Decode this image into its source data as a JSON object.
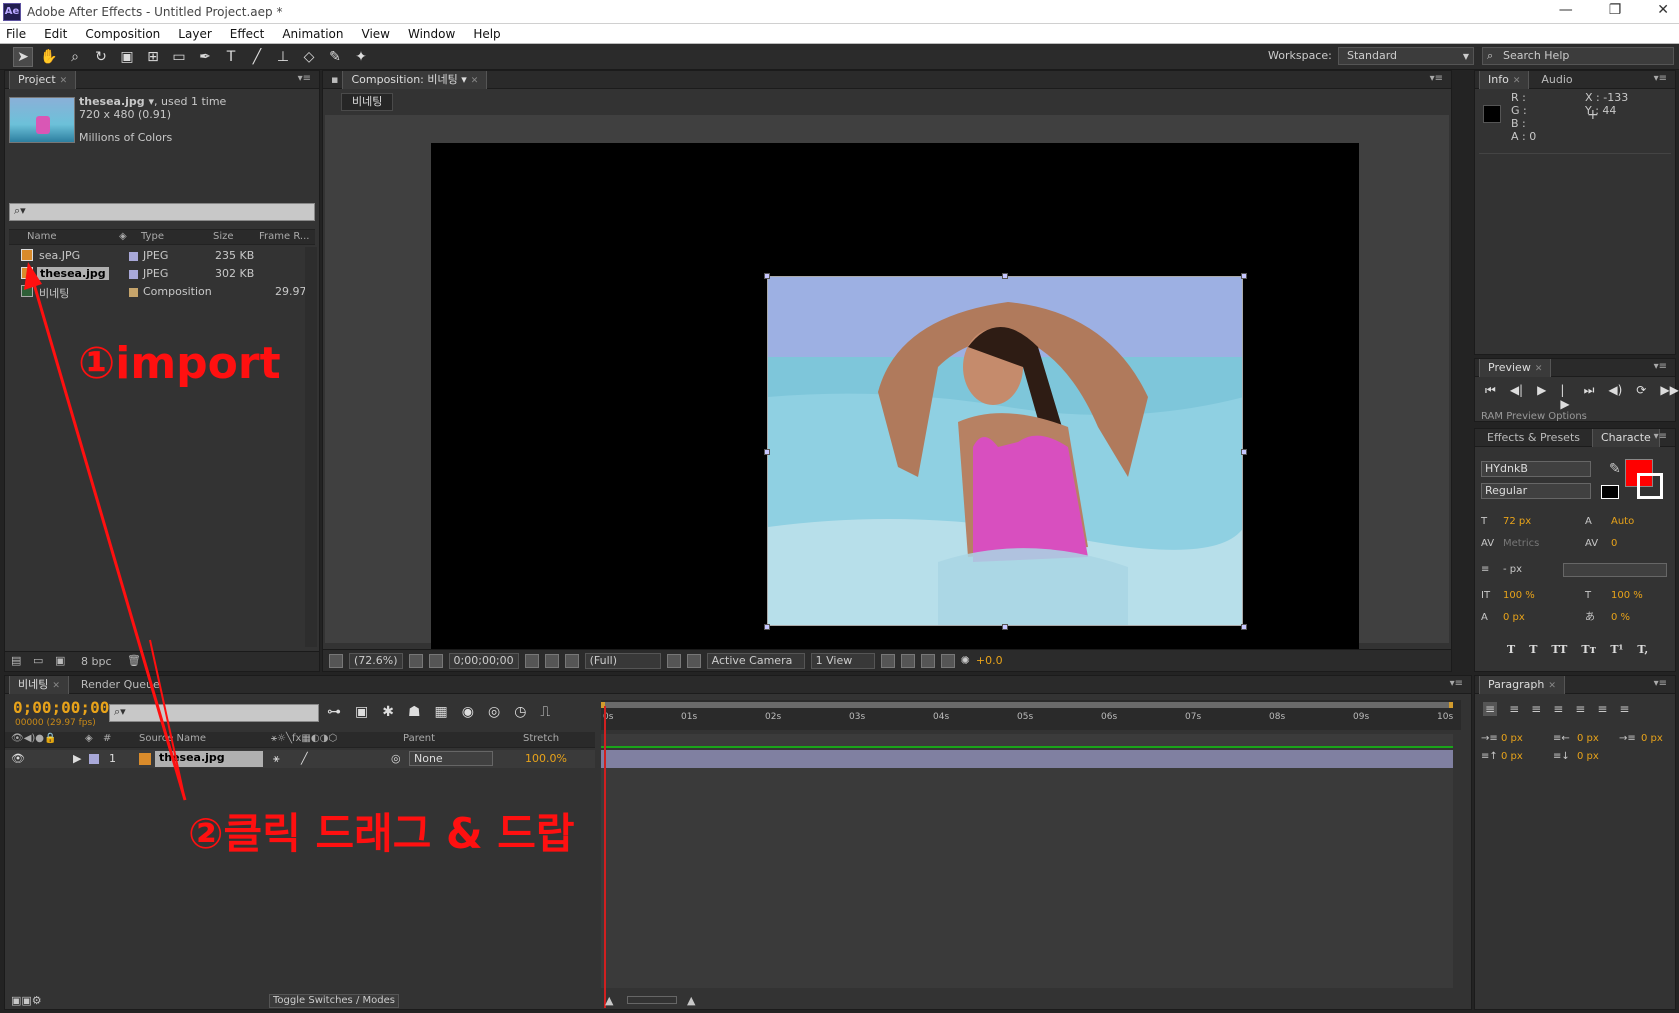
{
  "window": {
    "app_icon": "Ae",
    "title": "Adobe After Effects - Untitled Project.aep *",
    "min": "—",
    "restore": "❐",
    "close": "✕"
  },
  "menu": [
    "File",
    "Edit",
    "Composition",
    "Layer",
    "Effect",
    "Animation",
    "View",
    "Window",
    "Help"
  ],
  "toolbar": {
    "workspace_label": "Workspace:",
    "workspace_value": "Standard",
    "search_help": "Search Help"
  },
  "project": {
    "tab": "Project",
    "selected_name": "thesea.jpg ▾",
    "used": ", used 1 time",
    "dimensions": "720 x 480 (0.91)",
    "colors": "Millions of Colors",
    "search_placeholder": "⌕▾",
    "columns": {
      "name": "Name",
      "type": "Type",
      "size": "Size",
      "frame": "Frame R..."
    },
    "items": [
      {
        "name": "sea.JPG",
        "type": "JPEG",
        "size": "235 KB",
        "frame": ""
      },
      {
        "name": "thesea.jpg",
        "type": "JPEG",
        "size": "302 KB",
        "frame": ""
      },
      {
        "name": "비네팅",
        "type": "Composition",
        "size": "",
        "frame": "29.97"
      }
    ],
    "bpc": "8 bpc"
  },
  "composition": {
    "tab": "Composition: 비네팅",
    "breadcrumb": "비네팅",
    "zoom": "(72.6%)",
    "timecode": "0;00;00;00",
    "resolution": "(Full)",
    "camera": "Active Camera",
    "views": "1 View",
    "exposure": "+0.0"
  },
  "info": {
    "tabs": [
      "Info",
      "Audio"
    ],
    "r": "R :",
    "g": "G :",
    "b": "B :",
    "a": "A : 0",
    "x": "X : -133",
    "y": "Y : 44"
  },
  "preview": {
    "tab": "Preview",
    "ram": "RAM Preview Options"
  },
  "character": {
    "tabs": [
      "Effects & Presets",
      "Characte"
    ],
    "font": "HYdnkB",
    "style": "Regular",
    "size": "72 px",
    "leading": "Auto",
    "kerning": "Metrics",
    "tracking": "0",
    "stroke": "- px",
    "vscale": "100 %",
    "hscale": "100 %",
    "baseline": "0 px",
    "tsume": "0 %",
    "fill_color": "#ff0000",
    "styles": [
      "T",
      "T",
      "TT",
      "Tт",
      "T¹",
      "T,"
    ]
  },
  "paragraph": {
    "tab": "Paragraph",
    "indent1": "0 px",
    "indent2": "0 px",
    "indent3": "0 px",
    "space1": "0 px",
    "space2": "0 px"
  },
  "timeline": {
    "tabs": [
      "비네팅",
      "Render Queue"
    ],
    "timecode": "0;00;00;00",
    "fps": "00000 (29.97 fps)",
    "columns": {
      "num": "#",
      "source": "Source Name",
      "parent": "Parent",
      "stretch": "Stretch"
    },
    "layer": {
      "num": "1",
      "name": "thesea.jpg",
      "parent": "None",
      "stretch": "100.0%"
    },
    "ruler": [
      "0s",
      "01s",
      "02s",
      "03s",
      "04s",
      "05s",
      "06s",
      "07s",
      "08s",
      "09s",
      "10s"
    ],
    "toggle": "Toggle Switches / Modes"
  },
  "annotations": {
    "step1": "①import",
    "step2": "②클릭 드래그 & 드랍"
  }
}
